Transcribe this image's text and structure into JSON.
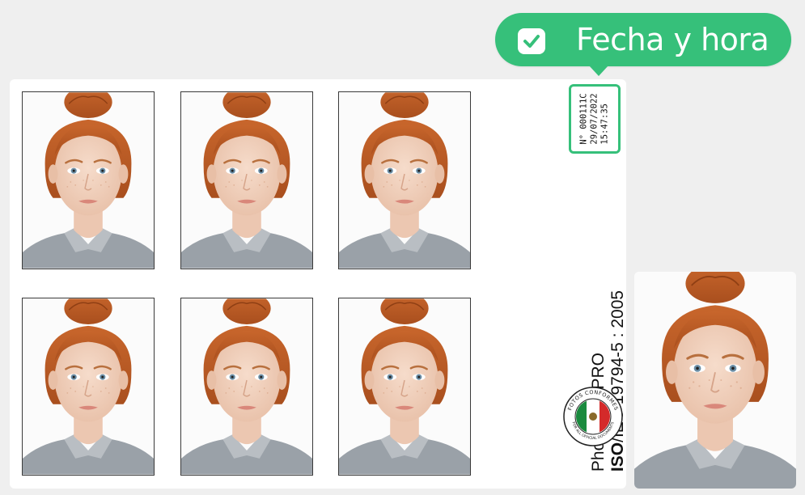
{
  "callout": {
    "label": "Fecha y hora",
    "icon": "check-icon",
    "color": "#36c07a"
  },
  "stamp": {
    "number": "N° 000111C",
    "date": "29/07/2022",
    "time": "15:47:35"
  },
  "branding": {
    "product": "Photo/foto PRO",
    "standard_bold": "ISO",
    "standard_rest": "/IEC 19794-5 : 2005"
  },
  "seal": {
    "top_text": "FOTOS CONFORMES",
    "bottom_text": "FOR ALL OFFICIAL DOCUMENTS",
    "icon": "mexico-flag-seal-icon"
  },
  "photos": [
    {
      "name": "passport-photo-1"
    },
    {
      "name": "passport-photo-2"
    },
    {
      "name": "passport-photo-3"
    },
    {
      "name": "passport-photo-4"
    },
    {
      "name": "passport-photo-5"
    },
    {
      "name": "passport-photo-6"
    }
  ]
}
